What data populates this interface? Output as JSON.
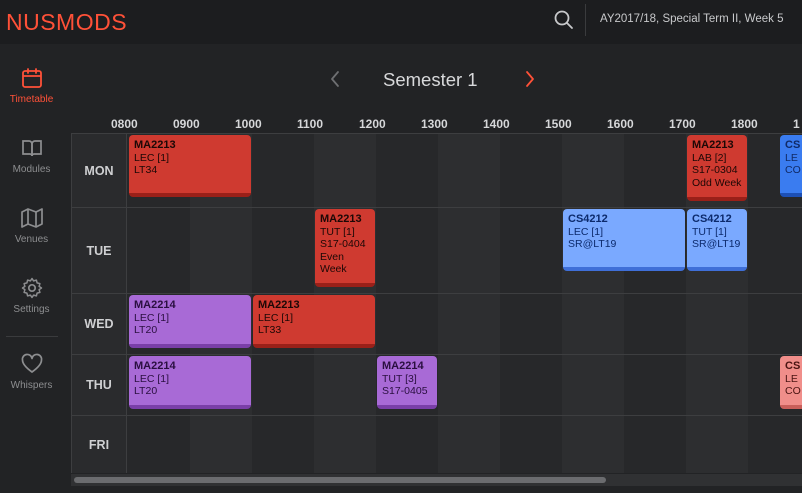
{
  "app": {
    "logo": "NUSMODS",
    "term": "AY2017/18, Special Term II, Week 5"
  },
  "sidebar": {
    "items": [
      {
        "label": "Timetable",
        "icon": "calendar-icon",
        "active": true
      },
      {
        "label": "Modules",
        "icon": "book-icon"
      },
      {
        "label": "Venues",
        "icon": "map-icon"
      },
      {
        "label": "Settings",
        "icon": "gear-icon"
      },
      {
        "label": "Whispers",
        "icon": "heart-icon"
      }
    ]
  },
  "semester": {
    "title": "Semester 1"
  },
  "timetable": {
    "hours": [
      "0800",
      "0900",
      "1000",
      "1100",
      "1200",
      "1300",
      "1400",
      "1500",
      "1600",
      "1700",
      "1800",
      "1"
    ],
    "days": [
      "MON",
      "TUE",
      "WED",
      "THU",
      "FRI"
    ],
    "lessons": [
      {
        "day": "MON",
        "code": "MA2213",
        "type": "LEC [1]",
        "venue": "LT34",
        "start": "0800",
        "end": "1000",
        "color": "#cf3a30"
      },
      {
        "day": "MON",
        "code": "MA2213",
        "type": "LAB [2]",
        "venue": "S17-0304",
        "extra": "Odd Week",
        "start": "1700",
        "end": "1800",
        "color": "#cf3a30"
      },
      {
        "day": "MON",
        "code": "CS",
        "type": "LE",
        "venue": "CO",
        "start": "1830",
        "end": "2000",
        "color": "#3a7cf0"
      },
      {
        "day": "TUE",
        "code": "MA2213",
        "type": "TUT [1]",
        "venue": "S17-0404",
        "extra": "Even Week",
        "start": "1100",
        "end": "1200",
        "color": "#cf3a30"
      },
      {
        "day": "TUE",
        "code": "CS4212",
        "type": "LEC [1]",
        "venue": "SR@LT19",
        "start": "1500",
        "end": "1700",
        "color": "#7aa9ff"
      },
      {
        "day": "TUE",
        "code": "CS4212",
        "type": "TUT [1]",
        "venue": "SR@LT19",
        "start": "1700",
        "end": "1800",
        "color": "#7aa9ff"
      },
      {
        "day": "WED",
        "code": "MA2214",
        "type": "LEC [1]",
        "venue": "LT20",
        "start": "0800",
        "end": "1000",
        "color": "#a86ad6"
      },
      {
        "day": "WED",
        "code": "MA2213",
        "type": "LEC [1]",
        "venue": "LT33",
        "start": "1000",
        "end": "1200",
        "color": "#cf3a30"
      },
      {
        "day": "THU",
        "code": "MA2214",
        "type": "LEC [1]",
        "venue": "LT20",
        "start": "0800",
        "end": "1000",
        "color": "#a86ad6"
      },
      {
        "day": "THU",
        "code": "MA2214",
        "type": "TUT [3]",
        "venue": "S17-0405",
        "start": "1200",
        "end": "1300",
        "color": "#a86ad6"
      },
      {
        "day": "THU",
        "code": "CS",
        "type": "LE",
        "venue": "CO",
        "start": "1830",
        "end": "2000",
        "color": "#f08e8a"
      }
    ]
  }
}
